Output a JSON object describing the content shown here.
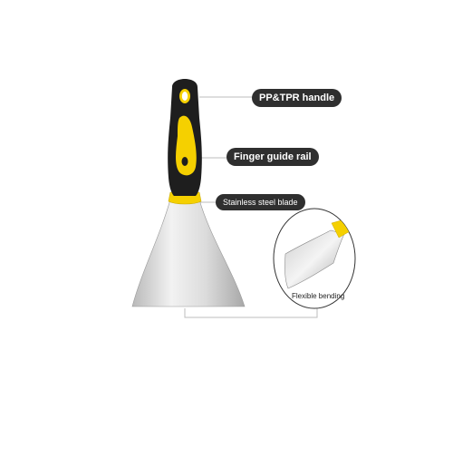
{
  "callouts": {
    "handle": "PP&TPR handle",
    "finger_rail": "Finger guide rail",
    "blade": "Stainless steel blade",
    "flex": "Flexible bending"
  },
  "colors": {
    "handle_black": "#1e1e1e",
    "handle_yellow": "#f5d000",
    "blade_steel": "#d6d6d6",
    "callout_bg": "#2f2f2f",
    "leader_line": "#bdbdbd"
  }
}
